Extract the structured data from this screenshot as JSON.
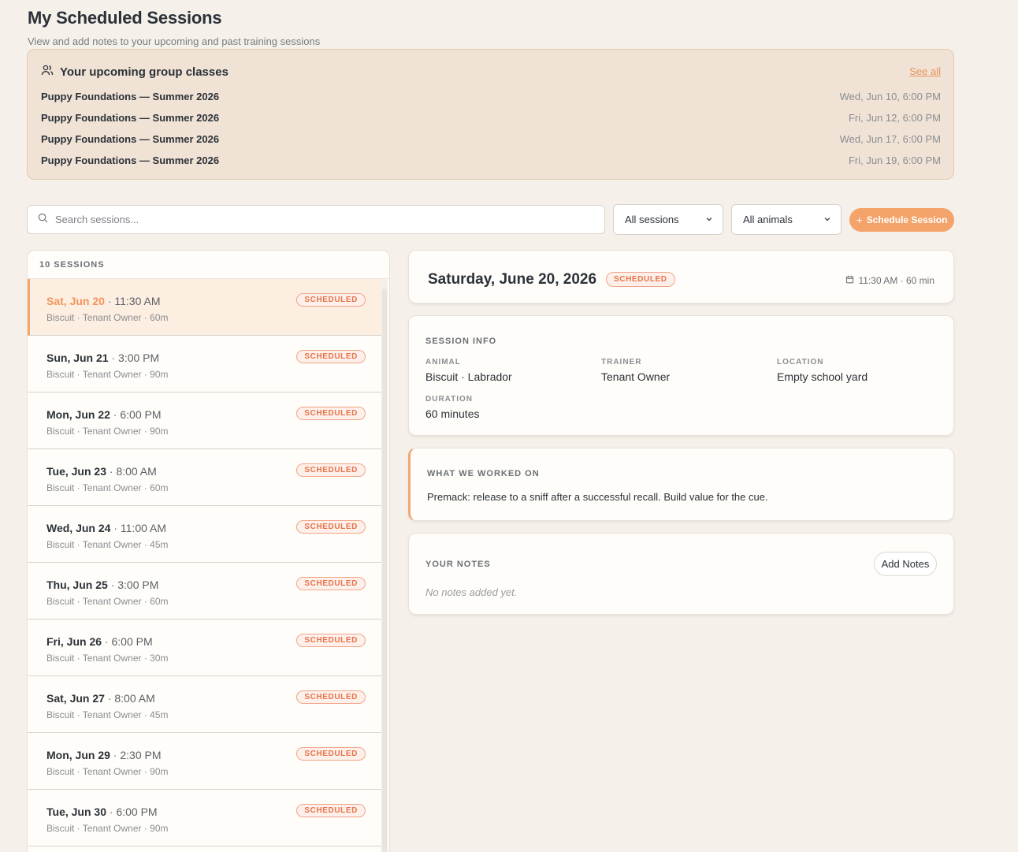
{
  "header": {
    "title": "My Scheduled Sessions",
    "subtitle": "View and add notes to your upcoming and past training sessions"
  },
  "group_classes": {
    "title": "Your upcoming group classes",
    "see_all": "See all",
    "rows": [
      {
        "name": "Puppy Foundations — Summer 2026",
        "when": "Wed, Jun 10, 6:00 PM"
      },
      {
        "name": "Puppy Foundations — Summer 2026",
        "when": "Fri, Jun 12, 6:00 PM"
      },
      {
        "name": "Puppy Foundations — Summer 2026",
        "when": "Wed, Jun 17, 6:00 PM"
      },
      {
        "name": "Puppy Foundations — Summer 2026",
        "when": "Fri, Jun 19, 6:00 PM"
      }
    ]
  },
  "toolbar": {
    "search_placeholder": "Search sessions...",
    "session_filter": "All sessions",
    "animal_filter": "All animals",
    "schedule_label": "Schedule Session"
  },
  "session_list": {
    "count_label": "10 SESSIONS",
    "items": [
      {
        "date": "Sat, Jun 20",
        "time": "11:30 AM",
        "meta": "Biscuit · Tenant Owner · 60m",
        "status": "SCHEDULED"
      },
      {
        "date": "Sun, Jun 21",
        "time": "3:00 PM",
        "meta": "Biscuit · Tenant Owner · 90m",
        "status": "SCHEDULED"
      },
      {
        "date": "Mon, Jun 22",
        "time": "6:00 PM",
        "meta": "Biscuit · Tenant Owner · 90m",
        "status": "SCHEDULED"
      },
      {
        "date": "Tue, Jun 23",
        "time": "8:00 AM",
        "meta": "Biscuit · Tenant Owner · 60m",
        "status": "SCHEDULED"
      },
      {
        "date": "Wed, Jun 24",
        "time": "11:00 AM",
        "meta": "Biscuit · Tenant Owner · 45m",
        "status": "SCHEDULED"
      },
      {
        "date": "Thu, Jun 25",
        "time": "3:00 PM",
        "meta": "Biscuit · Tenant Owner · 60m",
        "status": "SCHEDULED"
      },
      {
        "date": "Fri, Jun 26",
        "time": "6:00 PM",
        "meta": "Biscuit · Tenant Owner · 30m",
        "status": "SCHEDULED"
      },
      {
        "date": "Sat, Jun 27",
        "time": "8:00 AM",
        "meta": "Biscuit · Tenant Owner · 45m",
        "status": "SCHEDULED"
      },
      {
        "date": "Mon, Jun 29",
        "time": "2:30 PM",
        "meta": "Biscuit · Tenant Owner · 90m",
        "status": "SCHEDULED"
      },
      {
        "date": "Tue, Jun 30",
        "time": "6:00 PM",
        "meta": "Biscuit · Tenant Owner · 90m",
        "status": "SCHEDULED"
      }
    ]
  },
  "detail": {
    "title": "Saturday, June 20, 2026",
    "status": "SCHEDULED",
    "time": "11:30 AM · 60 min",
    "info_label": "SESSION INFO",
    "animal_label": "ANIMAL",
    "animal_value": "Biscuit · Labrador",
    "trainer_label": "TRAINER",
    "trainer_value": "Tenant Owner",
    "location_label": "LOCATION",
    "location_value": "Empty school yard",
    "duration_label": "DURATION",
    "duration_value": "60 minutes",
    "worked_label": "WHAT WE WORKED ON",
    "worked_text": "Premack: release to a sniff after a successful recall. Build value for the cue.",
    "notes_label": "YOUR NOTES",
    "add_notes": "Add Notes",
    "no_notes": "No notes added yet."
  },
  "colors": {
    "accent": "#f4a36b",
    "badge_text": "#e8734a",
    "background": "#f5f0ea"
  }
}
